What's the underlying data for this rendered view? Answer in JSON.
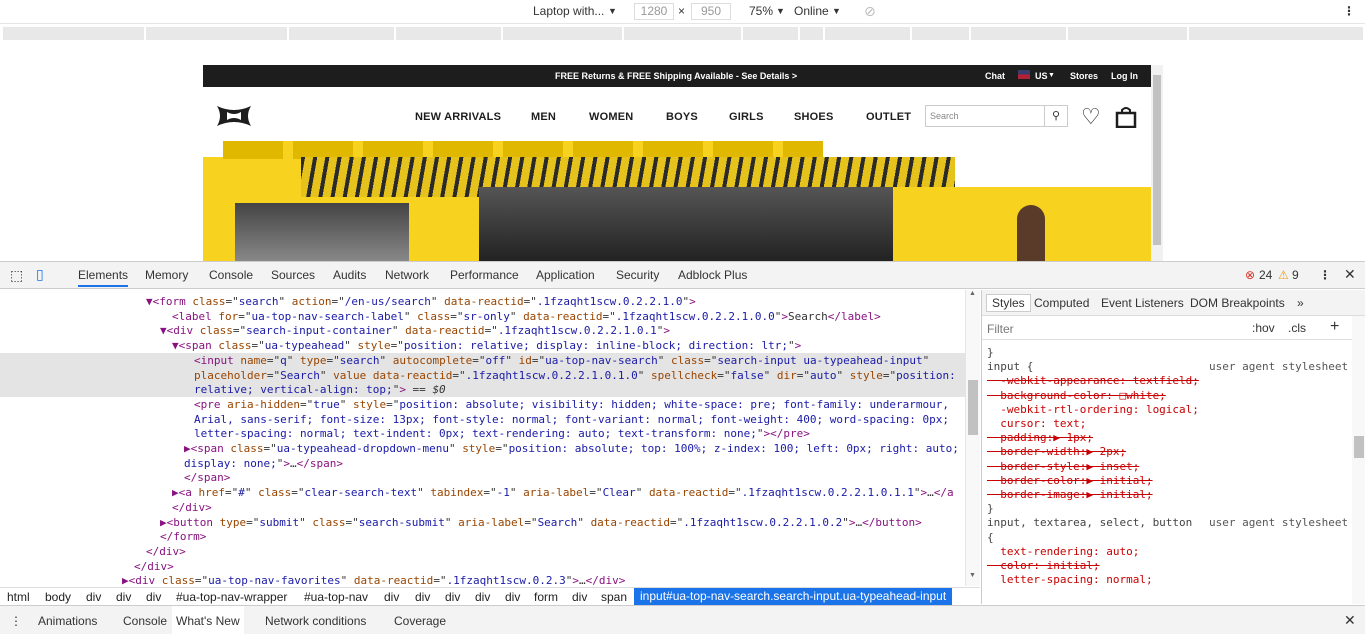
{
  "device_toolbar": {
    "device": "Laptop with...",
    "width": "1280",
    "times": "×",
    "height": "950",
    "zoom": "75%",
    "network": "Online"
  },
  "site": {
    "banner": "FREE Returns & FREE Shipping Available - See Details >",
    "top_links": [
      "Chat",
      "US",
      "Stores",
      "Log In"
    ],
    "nav": [
      "NEW ARRIVALS",
      "MEN",
      "WOMEN",
      "BOYS",
      "GIRLS",
      "SHOES",
      "OUTLET"
    ],
    "search_placeholder": "Search"
  },
  "devtools": {
    "tabs": [
      "Elements",
      "Memory",
      "Console",
      "Sources",
      "Audits",
      "Network",
      "Performance",
      "Application",
      "Security",
      "Adblock Plus"
    ],
    "errors": "24",
    "warnings": "9",
    "lines": [
      {
        "indent": 146,
        "html": "<span class='tag'>▼&lt;form</span> <span class='attr'>class</span>=\"<span class='val'>search</span>\" <span class='attr'>action</span>=\"<span class='val'>/en-us/search</span>\" <span class='attr'>data-reactid</span>=\"<span class='val'>.1fzaqht1scw.0.2.2.1.0</span>\"<span class='tag'>&gt;</span>"
      },
      {
        "indent": 172,
        "html": "<span class='tag'>&lt;label</span> <span class='attr'>for</span>=\"<span class='val'>ua-top-nav-search-label</span>\" <span class='attr'>class</span>=\"<span class='val'>sr-only</span>\" <span class='attr'>data-reactid</span>=\"<span class='val'>.1fzaqht1scw.0.2.2.1.0.0</span>\"<span class='tag'>&gt;</span>Search<span class='tag'>&lt;/label&gt;</span>"
      },
      {
        "indent": 160,
        "html": "<span class='tag'>▼&lt;div</span> <span class='attr'>class</span>=\"<span class='val'>search-input-container</span>\" <span class='attr'>data-reactid</span>=\"<span class='val'>.1fzaqht1scw.0.2.2.1.0.1</span>\"<span class='tag'>&gt;</span>"
      },
      {
        "indent": 172,
        "html": "<span class='tag'>▼&lt;span</span> <span class='attr'>class</span>=\"<span class='val'>ua-typeahead</span>\" <span class='attr'>style</span>=\"<span class='val'>position: relative; display: inline-block; direction: ltr;</span>\"<span class='tag'>&gt;</span>"
      },
      {
        "indent": 194,
        "sel": true,
        "html": "<span class='tag'>&lt;input</span> <span class='attr'>name</span>=\"<span class='val'>q</span>\" <span class='attr'>type</span>=\"<span class='val'>search</span>\" <span class='attr'>autocomplete</span>=\"<span class='val'>off</span>\" <span class='attr'>id</span>=\"<span class='val'>ua-top-nav-search</span>\" <span class='attr'>class</span>=\"<span class='val'>search-input ua-typeahead-input</span>\""
      },
      {
        "indent": 194,
        "sel": true,
        "html": "<span class='attr'>placeholder</span>=\"<span class='val'>Search</span>\" <span class='attr'>value</span> <span class='attr'>data-reactid</span>=\"<span class='val'>.1fzaqht1scw.0.2.2.1.0.1.0</span>\" <span class='attr'>spellcheck</span>=\"<span class='val'>false</span>\" <span class='attr'>dir</span>=\"<span class='val'>auto</span>\" <span class='attr'>style</span>=\"<span class='val'>position:</span>"
      },
      {
        "indent": 194,
        "sel": true,
        "html": "<span class='val'>relative; vertical-align: top;</span>\"<span class='tag'>&gt;</span> == <i>$0</i>"
      },
      {
        "indent": 194,
        "html": "<span class='tag'>&lt;pre</span> <span class='attr'>aria-hidden</span>=\"<span class='val'>true</span>\" <span class='attr'>style</span>=\"<span class='val'>position: absolute; visibility: hidden; white-space: pre; font-family: underarmour,</span>"
      },
      {
        "indent": 194,
        "html": "<span class='val'>Arial, sans-serif; font-size: 13px; font-style: normal; font-variant: normal; font-weight: 400; word-spacing: 0px;</span>"
      },
      {
        "indent": 194,
        "html": "<span class='val'>letter-spacing: normal; text-indent: 0px; text-rendering: auto; text-transform: none;</span>\"<span class='tag'>&gt;&lt;/pre&gt;</span>"
      },
      {
        "indent": 184,
        "html": "<span class='tag'>▶&lt;span</span> <span class='attr'>class</span>=\"<span class='val'>ua-typeahead-dropdown-menu</span>\" <span class='attr'>style</span>=\"<span class='val'>position: absolute; top: 100%; z-index: 100; left: 0px; right: auto;</span>"
      },
      {
        "indent": 184,
        "html": "<span class='val'>display: none;</span>\"<span class='tag'>&gt;</span>…<span class='tag'>&lt;/span&gt;</span>"
      },
      {
        "indent": 184,
        "html": "<span class='tag'>&lt;/span&gt;</span>"
      },
      {
        "indent": 172,
        "html": "<span class='tag'>▶&lt;a</span> <span class='attr'>href</span>=\"<span class='val'>#</span>\" <span class='attr'>class</span>=\"<span class='val'>clear-search-text</span>\" <span class='attr'>tabindex</span>=\"<span class='val'>-1</span>\" <span class='attr'>aria-label</span>=\"<span class='val'>Clear</span>\" <span class='attr'>data-reactid</span>=\"<span class='val'>.1fzaqht1scw.0.2.2.1.0.1.1</span>\"<span class='tag'>&gt;</span>…<span class='tag'>&lt;/a</span>"
      },
      {
        "indent": 172,
        "html": "<span class='tag'>&lt;/div&gt;</span>"
      },
      {
        "indent": 160,
        "html": "<span class='tag'>▶&lt;button</span> <span class='attr'>type</span>=\"<span class='val'>submit</span>\" <span class='attr'>class</span>=\"<span class='val'>search-submit</span>\" <span class='attr'>aria-label</span>=\"<span class='val'>Search</span>\" <span class='attr'>data-reactid</span>=\"<span class='val'>.1fzaqht1scw.0.2.2.1.0.2</span>\"<span class='tag'>&gt;</span>…<span class='tag'>&lt;/button&gt;</span>"
      },
      {
        "indent": 160,
        "html": "<span class='tag'>&lt;/form&gt;</span>"
      },
      {
        "indent": 146,
        "html": "<span class='tag'>&lt;/div&gt;</span>"
      },
      {
        "indent": 134,
        "html": "<span class='tag'>&lt;/div&gt;</span>"
      },
      {
        "indent": 122,
        "html": "<span class='tag'>▶&lt;div</span> <span class='attr'>class</span>=\"<span class='val'>ua-top-nav-favorites</span>\" <span class='attr'>data-reactid</span>=\"<span class='val'>.1fzaqht1scw.0.2.3</span>\"<span class='tag'>&gt;</span>…<span class='tag'>&lt;/div&gt;</span>"
      }
    ],
    "breadcrumbs": [
      "html",
      "body",
      "div",
      "div",
      "div",
      "#ua-top-nav-wrapper",
      "#ua-top-nav",
      "div",
      "div",
      "div",
      "div",
      "div",
      "form",
      "div",
      "span"
    ],
    "breadcrumb_selected": "input#ua-top-nav-search.search-input.ua-typeahead-input",
    "side_tabs": [
      "Styles",
      "Computed",
      "Event Listeners",
      "DOM Breakpoints"
    ],
    "filter_placeholder": "Filter",
    "hov": ":hov",
    "cls": ".cls",
    "styles": [
      {
        "text": "}",
        "cls": "cmt"
      },
      {
        "text": "input {",
        "cls": "cmt",
        "src": "user agent stylesheet"
      },
      {
        "text": "  -webkit-appearance: textfield;",
        "cls": "strike"
      },
      {
        "text": "  background-color: □white;",
        "cls": "strike"
      },
      {
        "text": "  -webkit-rtl-ordering: logical;",
        "cls": "prop"
      },
      {
        "text": "  cursor: text;",
        "cls": "prop"
      },
      {
        "text": "  padding:▶ 1px;",
        "cls": "strike"
      },
      {
        "text": "  border-width:▶ 2px;",
        "cls": "strike"
      },
      {
        "text": "  border-style:▶ inset;",
        "cls": "strike"
      },
      {
        "text": "  border-color:▶ initial;",
        "cls": "strike"
      },
      {
        "text": "  border-image:▶ initial;",
        "cls": "strike"
      },
      {
        "text": "}",
        "cls": "cmt"
      },
      {
        "text": "input, textarea, select, button",
        "cls": "cmt",
        "src": "user agent stylesheet"
      },
      {
        "text": "{",
        "cls": "cmt"
      },
      {
        "text": "  text-rendering: auto;",
        "cls": "prop"
      },
      {
        "text": "  color: initial;",
        "cls": "strike"
      },
      {
        "text": "  letter-spacing: normal;",
        "cls": "prop"
      }
    ],
    "drawer_tabs": [
      "Animations",
      "Console",
      "What's New",
      "Network conditions",
      "Coverage"
    ]
  }
}
